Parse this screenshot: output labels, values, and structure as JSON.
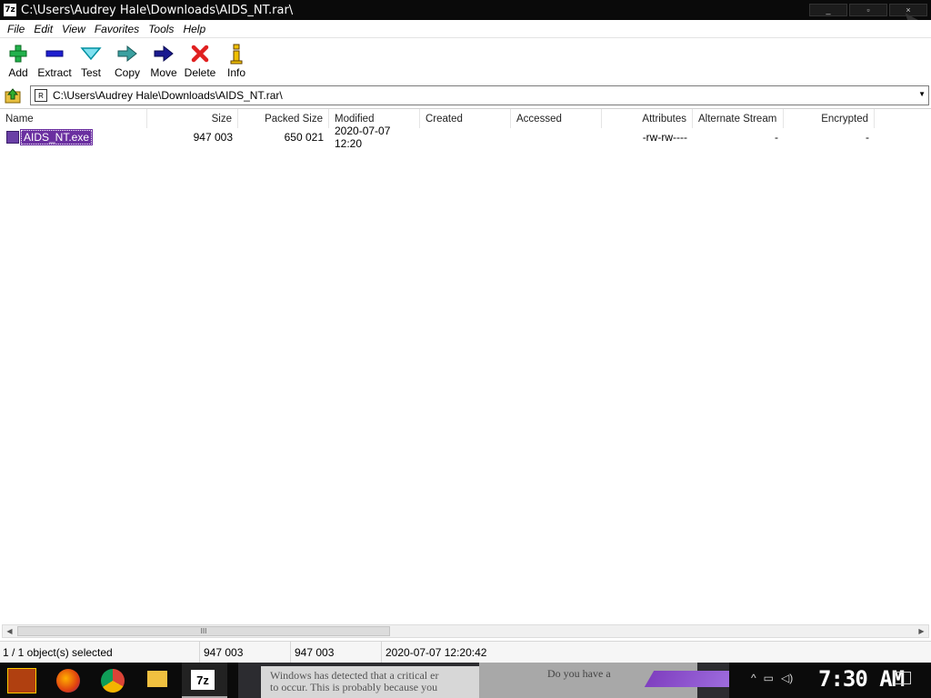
{
  "window": {
    "title": "C:\\Users\\Audrey Hale\\Downloads\\AIDS_NT.rar\\",
    "app_icon_text": "7z",
    "controls": [
      "minimize-icon",
      "maximize-icon",
      "close-icon"
    ]
  },
  "menu": [
    "File",
    "Edit",
    "View",
    "Favorites",
    "Tools",
    "Help"
  ],
  "toolbar": [
    {
      "label": "Add",
      "icon": "plus-icon",
      "color": "#22b14c"
    },
    {
      "label": "Extract",
      "icon": "minus-icon",
      "color": "#1f1fd0"
    },
    {
      "label": "Test",
      "icon": "check-down-icon",
      "color": "#00a0b0"
    },
    {
      "label": "Copy",
      "icon": "double-arrow-icon",
      "color": "#2a8a8a"
    },
    {
      "label": "Move",
      "icon": "arrow-right-icon",
      "color": "#1a1a8a"
    },
    {
      "label": "Delete",
      "icon": "x-icon",
      "color": "#e02020"
    },
    {
      "label": "Info",
      "icon": "info-icon",
      "color": "#d0a000"
    }
  ],
  "address": {
    "path": "C:\\Users\\Audrey Hale\\Downloads\\AIDS_NT.rar\\"
  },
  "columns": [
    "Name",
    "Size",
    "Packed Size",
    "Modified",
    "Created",
    "Accessed",
    "Attributes",
    "Alternate Stream",
    "Encrypted"
  ],
  "rows": [
    {
      "name": "AIDS_NT.exe",
      "size": "947 003",
      "packed": "650 021",
      "modified": "2020-07-07 12:20",
      "created": "",
      "accessed": "",
      "attributes": "-rw-rw----",
      "alternate": "-",
      "encrypted": "-"
    }
  ],
  "scroll_thumb_glyph": "III",
  "status": {
    "selected": "1 / 1 object(s) selected",
    "size": "947 003",
    "packed": "947 003",
    "modified": "2020-07-07 12:20:42"
  },
  "taskbar": {
    "apps": [
      "start-icon",
      "firefox-icon",
      "chrome-icon",
      "folder-icon",
      "7zip-icon"
    ],
    "app_7z_label": "7z",
    "wallpaper_text_1": "Windows has detected that a critical er",
    "wallpaper_text_2": "to occur. This is probably because you",
    "wallpaper_text_3": "Do you have a ",
    "clock": "7:30 AM"
  }
}
